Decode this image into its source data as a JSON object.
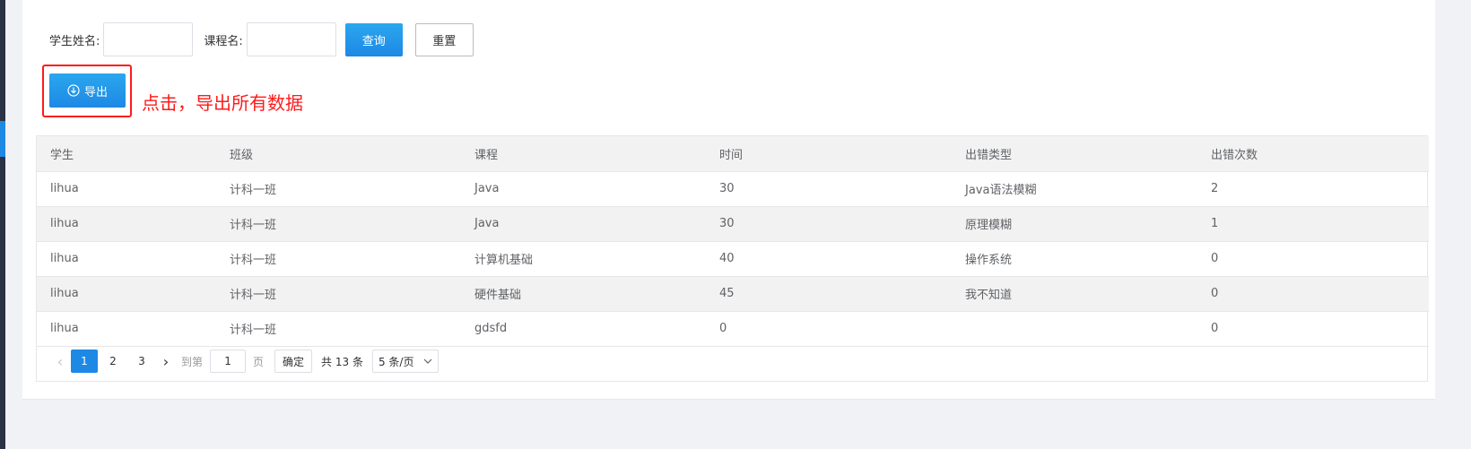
{
  "search": {
    "student_label": "学生姓名:",
    "course_label": "课程名:",
    "student_value": "",
    "course_value": "",
    "query_label": "查询",
    "reset_label": "重置"
  },
  "export": {
    "label": "导出",
    "annotation": "点击，导出所有数据",
    "icon": "download-circle-icon"
  },
  "colors": {
    "primary": "#1e88e5",
    "annotation": "#ff1a1a",
    "header_bg": "#f2f2f2"
  },
  "table": {
    "columns": [
      "学生",
      "班级",
      "课程",
      "时间",
      "出错类型",
      "出错次数"
    ],
    "rows": [
      [
        "lihua",
        "计科一班",
        "Java",
        "30",
        "Java语法模糊",
        "2"
      ],
      [
        "lihua",
        "计科一班",
        "Java",
        "30",
        "原理模糊",
        "1"
      ],
      [
        "lihua",
        "计科一班",
        "计算机基础",
        "40",
        "操作系统",
        "0"
      ],
      [
        "lihua",
        "计科一班",
        "硬件基础",
        "45",
        "我不知道",
        "0"
      ],
      [
        "lihua",
        "计科一班",
        "gdsfd",
        "0",
        "",
        "0"
      ]
    ]
  },
  "pagination": {
    "pages": [
      "1",
      "2",
      "3"
    ],
    "current_page": 1,
    "goto_prefix": "到第",
    "goto_value": "1",
    "goto_suffix": "页",
    "confirm_label": "确定",
    "total_text": "共 13 条",
    "page_size_label": "5 条/页"
  }
}
